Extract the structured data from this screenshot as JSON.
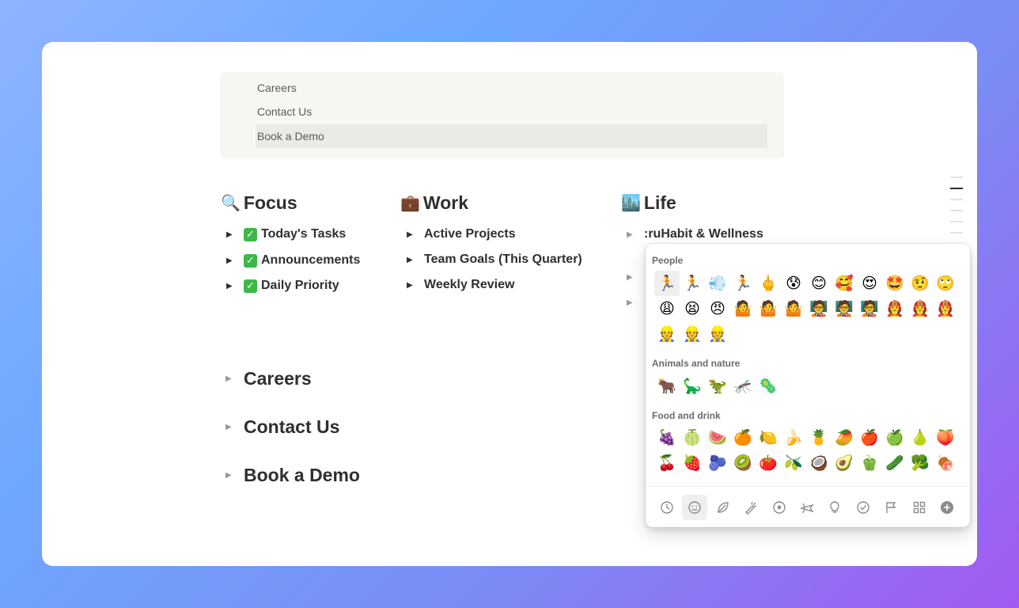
{
  "toc": {
    "items": [
      "Careers",
      "Contact Us",
      "Book a Demo"
    ]
  },
  "columns": {
    "focus": {
      "emoji": "🔍",
      "title": "Focus",
      "items": [
        "Today's Tasks",
        "Announcements",
        "Daily Priority"
      ]
    },
    "work": {
      "emoji": "💼",
      "title": "Work",
      "items": [
        "Active Projects",
        "Team Goals (This Quarter)",
        "Weekly Review"
      ]
    },
    "life": {
      "emoji": "🏙️",
      "title": "Life",
      "items": [
        ":ruHabit & Wellness"
      ]
    }
  },
  "toggles": [
    "Careers",
    "Contact Us",
    "Book a Demo"
  ],
  "picker": {
    "sections": {
      "people": "People",
      "animals": "Animals and nature",
      "food": "Food and drink"
    },
    "people_emojis": [
      "🏃",
      "🏃",
      "💨",
      "🏃",
      "🖕",
      "😰",
      "😊",
      "🥰",
      "😍",
      "🤩",
      "🤨",
      "🙄",
      "😩",
      "😫",
      "😠",
      "🤷",
      "🤷",
      "🤷",
      "🧑‍🏫",
      "🧑‍🏫",
      "🧑‍🏫",
      "👩‍🚒",
      "👩‍🚒",
      "👩‍🚒",
      "👷",
      "👷",
      "👷"
    ],
    "animal_emojis": [
      "🐂",
      "🦕",
      "🦖",
      "🦟",
      "🦠"
    ],
    "food_emojis": [
      "🍇",
      "🍈",
      "🍉",
      "🍊",
      "🍋",
      "🍌",
      "🍍",
      "🥭",
      "🍎",
      "🍏",
      "🍐",
      "🍑",
      "🍒",
      "🍓",
      "🫐",
      "🥝",
      "🍅",
      "🫒",
      "🥥",
      "🥑",
      "🫑",
      "🥒",
      "🥦",
      "🍖"
    ],
    "tabs": [
      "recent-icon",
      "smiley-icon",
      "leaf-icon",
      "carrot-icon",
      "ball-icon",
      "plane-icon",
      "bulb-icon",
      "check-icon",
      "flag-icon",
      "grid-icon",
      "add-icon"
    ],
    "accent": "#3db847"
  }
}
